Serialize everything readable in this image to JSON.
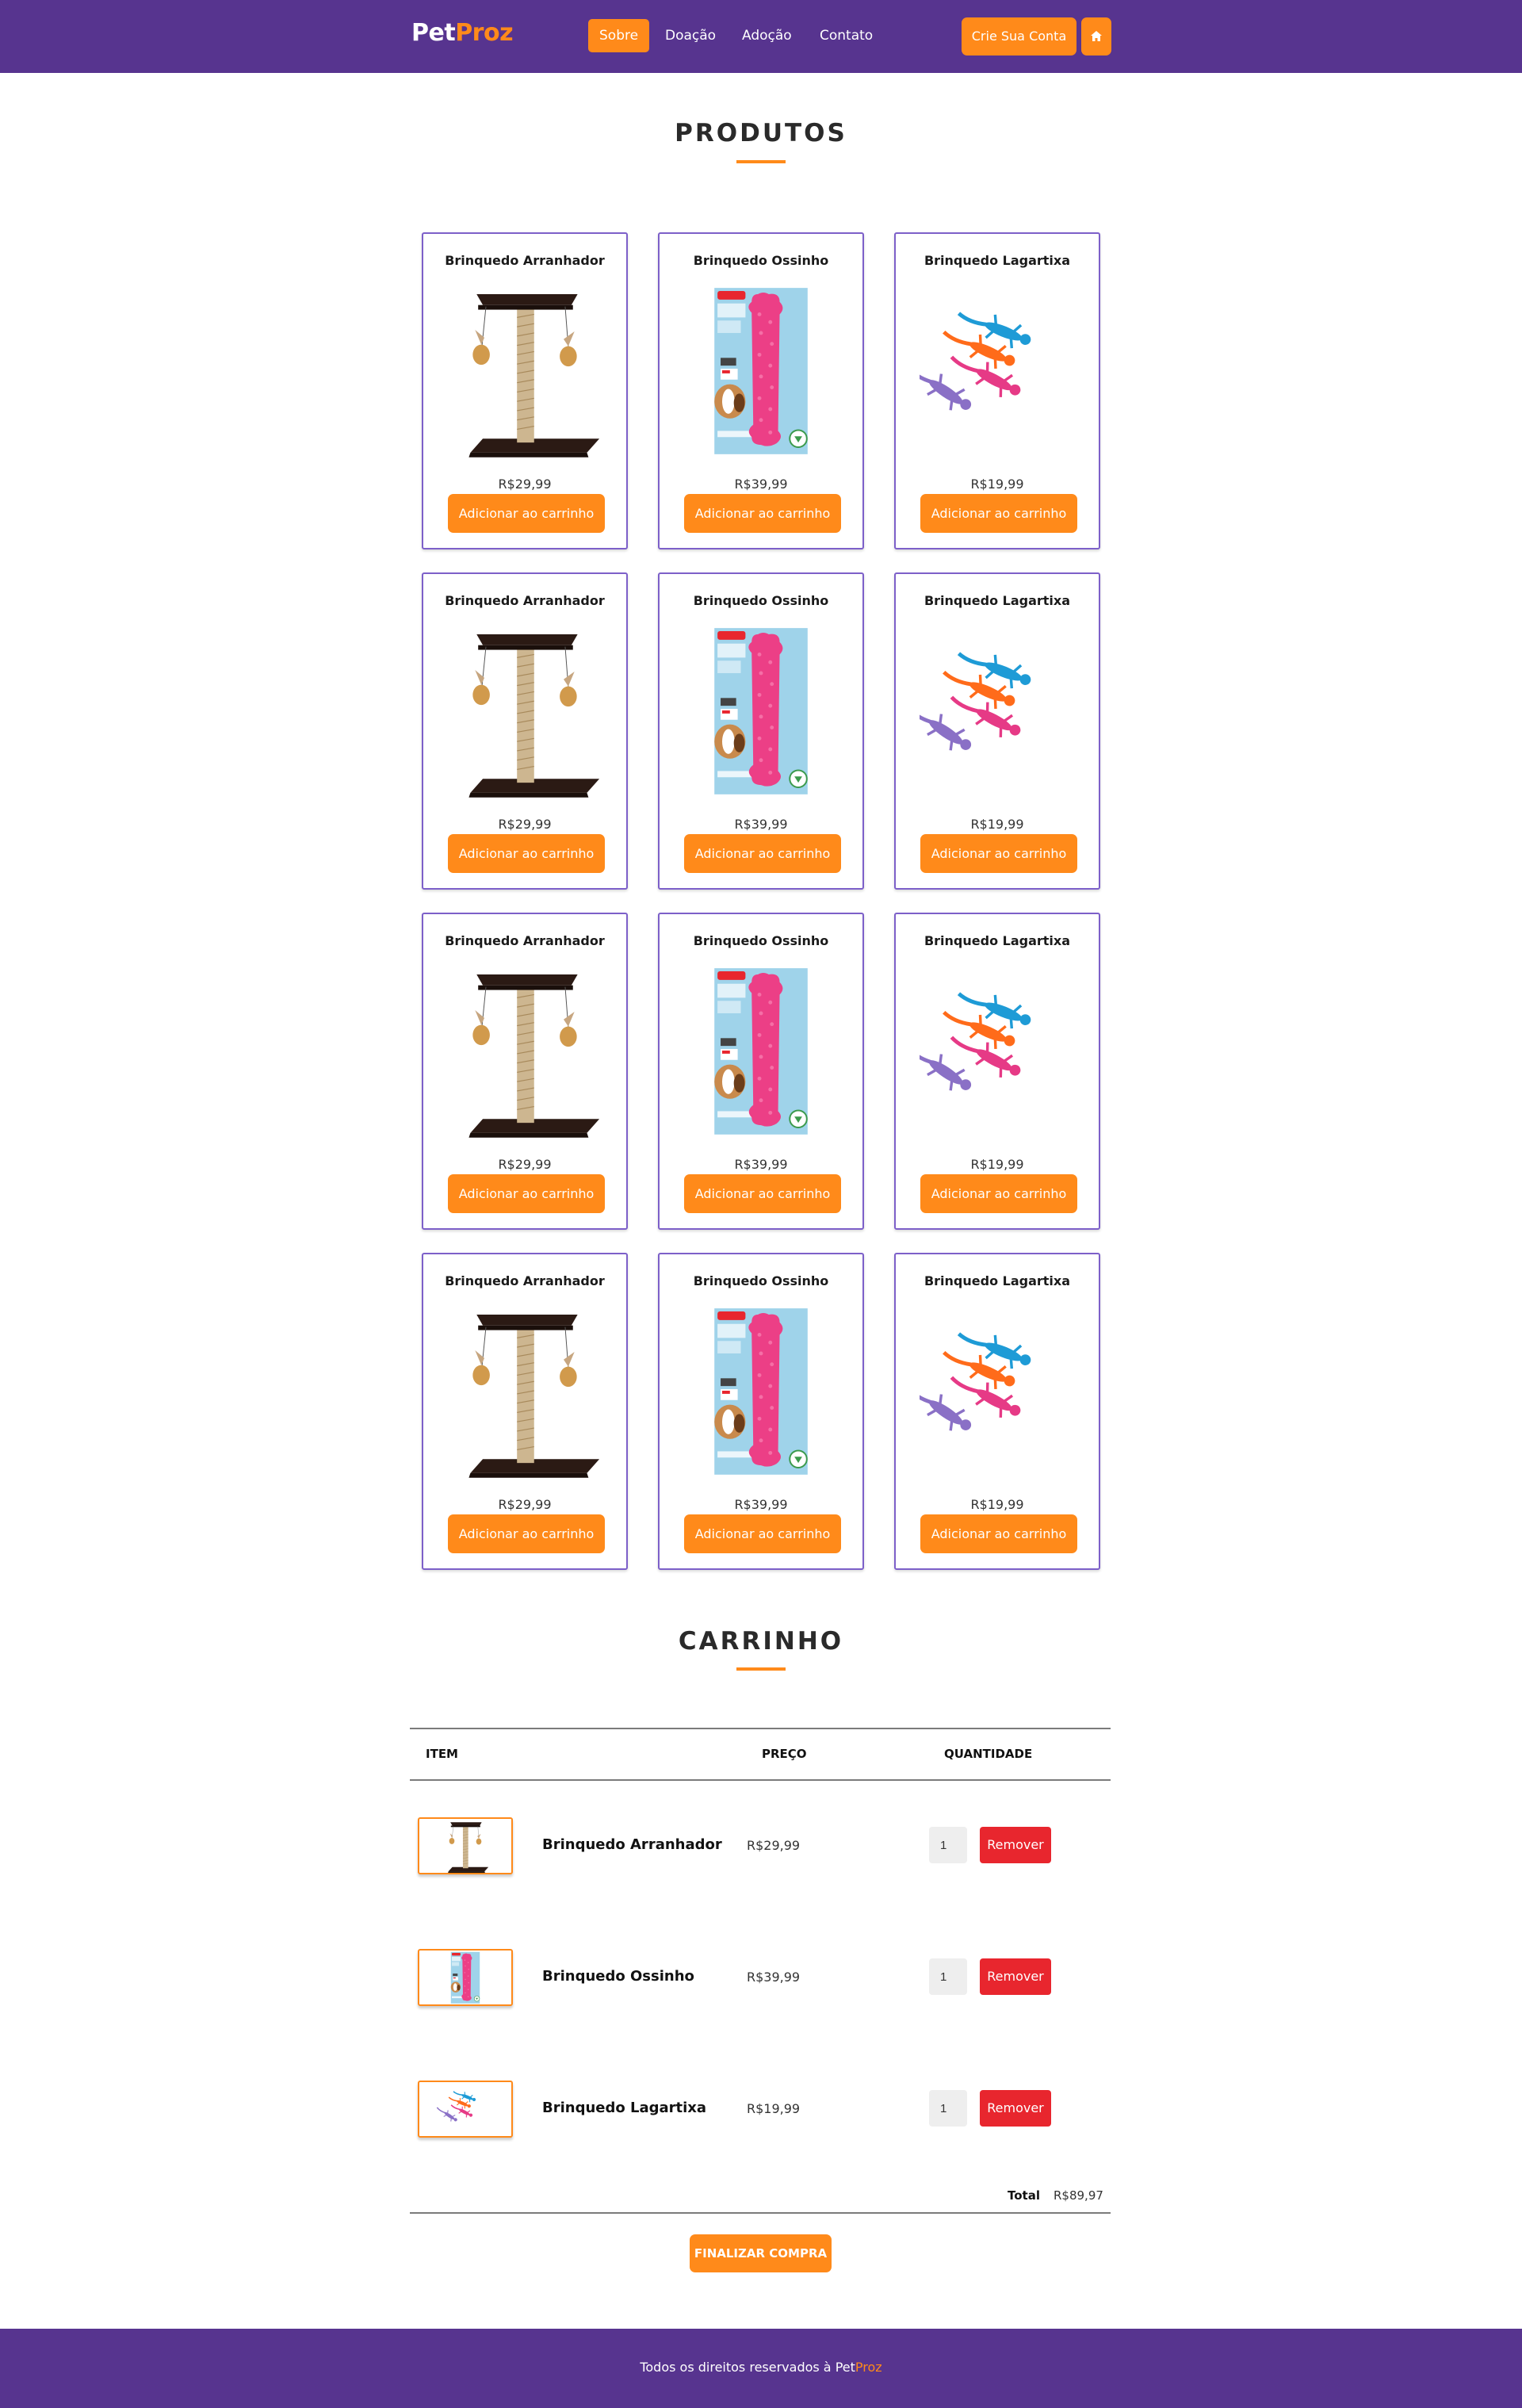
{
  "nav": {
    "brand_part1": "Pet",
    "brand_part2": "Proz",
    "links": [
      "Sobre",
      "Doação",
      "Adoção",
      "Contato"
    ],
    "cta_label": "Crie Sua Conta",
    "home_icon": "home-icon"
  },
  "products": {
    "title": "PRODUTOS",
    "add_label": "Adicionar ao carrinho",
    "items": [
      {
        "name": "Brinquedo Arranhador",
        "price": "R$29,99",
        "icon": "cat-scratcher-image"
      },
      {
        "name": "Brinquedo Ossinho",
        "price": "R$39,99",
        "icon": "bone-toy-image"
      },
      {
        "name": "Brinquedo Lagartixa",
        "price": "R$19,99",
        "icon": "lizard-toy-image"
      },
      {
        "name": "Brinquedo Arranhador",
        "price": "R$29,99",
        "icon": "cat-scratcher-image"
      },
      {
        "name": "Brinquedo Ossinho",
        "price": "R$39,99",
        "icon": "bone-toy-image"
      },
      {
        "name": "Brinquedo Lagartixa",
        "price": "R$19,99",
        "icon": "lizard-toy-image"
      },
      {
        "name": "Brinquedo Arranhador",
        "price": "R$29,99",
        "icon": "cat-scratcher-image"
      },
      {
        "name": "Brinquedo Ossinho",
        "price": "R$39,99",
        "icon": "bone-toy-image"
      },
      {
        "name": "Brinquedo Lagartixa",
        "price": "R$19,99",
        "icon": "lizard-toy-image"
      },
      {
        "name": "Brinquedo Arranhador",
        "price": "R$29,99",
        "icon": "cat-scratcher-image"
      },
      {
        "name": "Brinquedo Ossinho",
        "price": "R$39,99",
        "icon": "bone-toy-image"
      },
      {
        "name": "Brinquedo Lagartixa",
        "price": "R$19,99",
        "icon": "lizard-toy-image"
      }
    ]
  },
  "cart": {
    "title": "CARRINHO",
    "headers": {
      "item": "ITEM",
      "price": "PREÇO",
      "qty": "QUANTIDADE"
    },
    "remove_label": "Remover",
    "items": [
      {
        "name": "Brinquedo Arranhador",
        "price": "R$29,99",
        "qty": "1"
      },
      {
        "name": "Brinquedo Ossinho",
        "price": "R$39,99",
        "qty": "1"
      },
      {
        "name": "Brinquedo Lagartixa",
        "price": "R$19,99",
        "qty": "1"
      }
    ],
    "total_label": "Total",
    "total_value": "R$89,97",
    "checkout_label": "FINALIZAR COMPRA"
  },
  "footer": {
    "text": "Todos os direitos reservados à ",
    "brand_part1": "Pet",
    "brand_part2": "Proz"
  },
  "colors": {
    "primary": "#57348f",
    "accent": "#ff8a1a",
    "danger": "#e8262e"
  }
}
